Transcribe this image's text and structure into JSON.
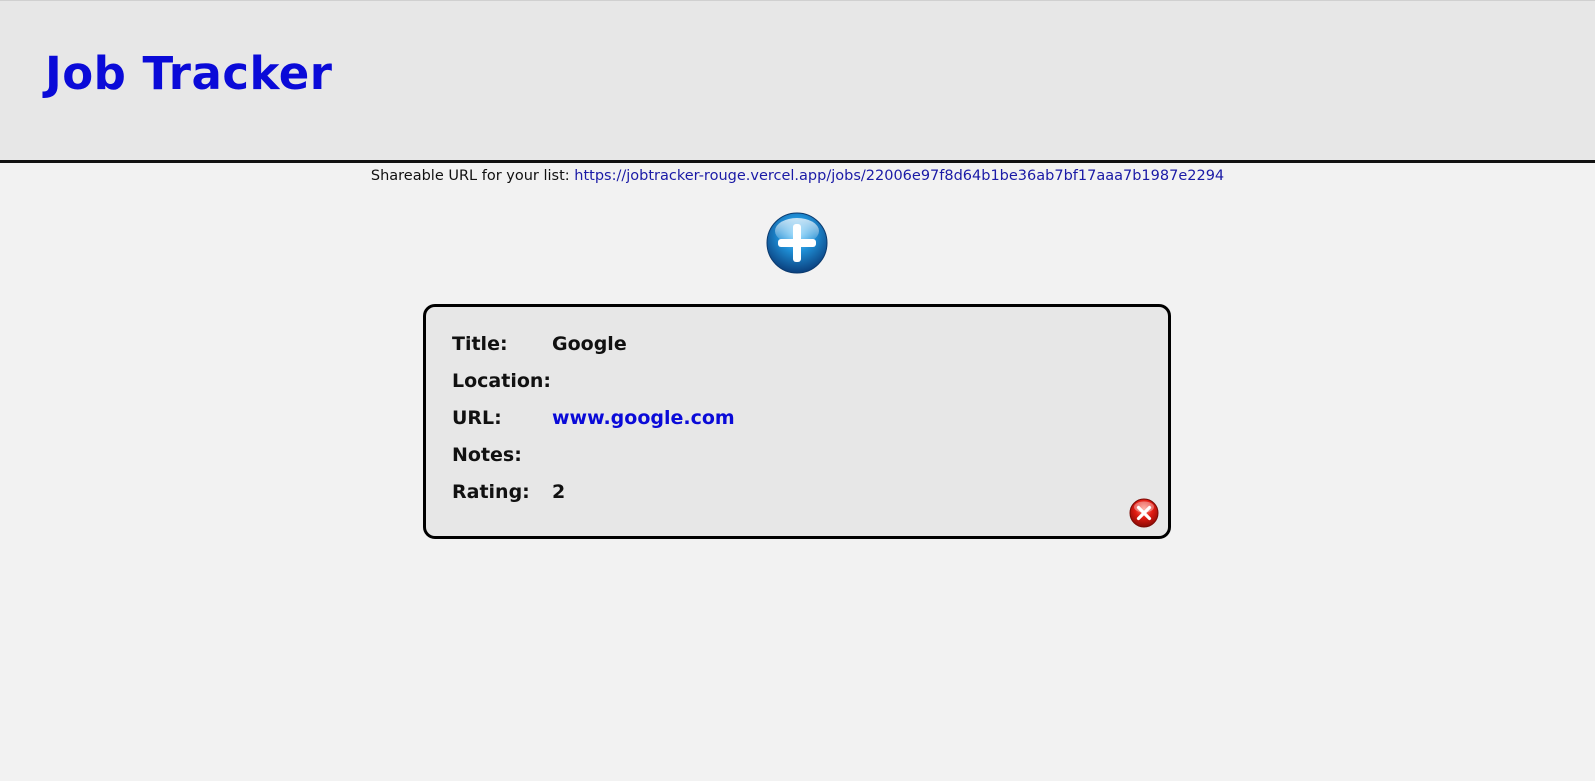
{
  "header": {
    "title": "Job Tracker"
  },
  "share": {
    "label": "Shareable URL for your list:",
    "url": "https://jobtracker-rouge.vercel.app/jobs/22006e97f8d64b1be36ab7bf17aaa7b1987e2294"
  },
  "add_button": {
    "icon": "plus-circle-icon"
  },
  "jobs": [
    {
      "fields": [
        {
          "label": "Title:",
          "value": "Google"
        },
        {
          "label": "Location:",
          "value": ""
        },
        {
          "label": "URL:",
          "value": "www.google.com"
        },
        {
          "label": "Notes:",
          "value": ""
        },
        {
          "label": "Rating:",
          "value": "2"
        }
      ],
      "delete_icon": "close-circle-icon"
    }
  ],
  "colors": {
    "title": "#0a0ad8",
    "link": "#1a1aa6",
    "header_bg": "#e7e7e7",
    "page_bg": "#f2f2f2",
    "card_border": "#000000"
  }
}
